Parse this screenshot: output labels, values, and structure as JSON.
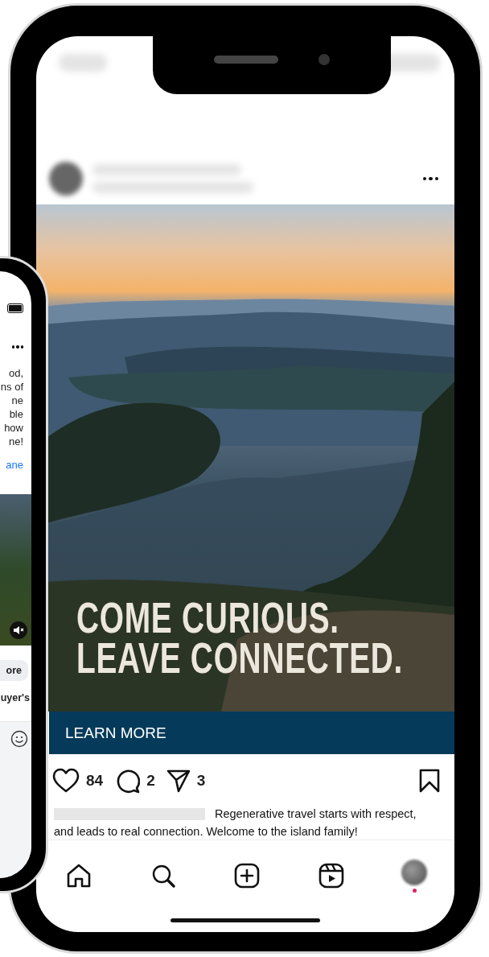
{
  "back_phone": {
    "lines": [
      {
        "text": "od,",
        "kind": "body"
      },
      {
        "text": "ns of",
        "kind": "body"
      },
      {
        "text": "ne",
        "kind": "body"
      },
      {
        "text": "ble",
        "kind": "body"
      },
      {
        "text": "how",
        "kind": "body"
      },
      {
        "text": "ne!",
        "kind": "body"
      },
      {
        "text": "ane",
        "kind": "link"
      }
    ],
    "pill": "ore",
    "row_text": "uyer's"
  },
  "post": {
    "headline": [
      "COME CURIOUS.",
      "LEAVE CONNECTED."
    ],
    "cta": "LEARN MORE",
    "actions": [
      {
        "kind": "like",
        "count": "84",
        "selected": false
      },
      {
        "kind": "comment",
        "count": "2",
        "selected": false
      },
      {
        "kind": "share",
        "count": "3",
        "selected": false
      }
    ],
    "saved": false,
    "caption": "Regenerative travel starts with respect, and leads to real connection. Welcome to the island family!"
  },
  "nav": [
    {
      "kind": "home"
    },
    {
      "kind": "search"
    },
    {
      "kind": "create"
    },
    {
      "kind": "reels"
    },
    {
      "kind": "profile"
    }
  ]
}
